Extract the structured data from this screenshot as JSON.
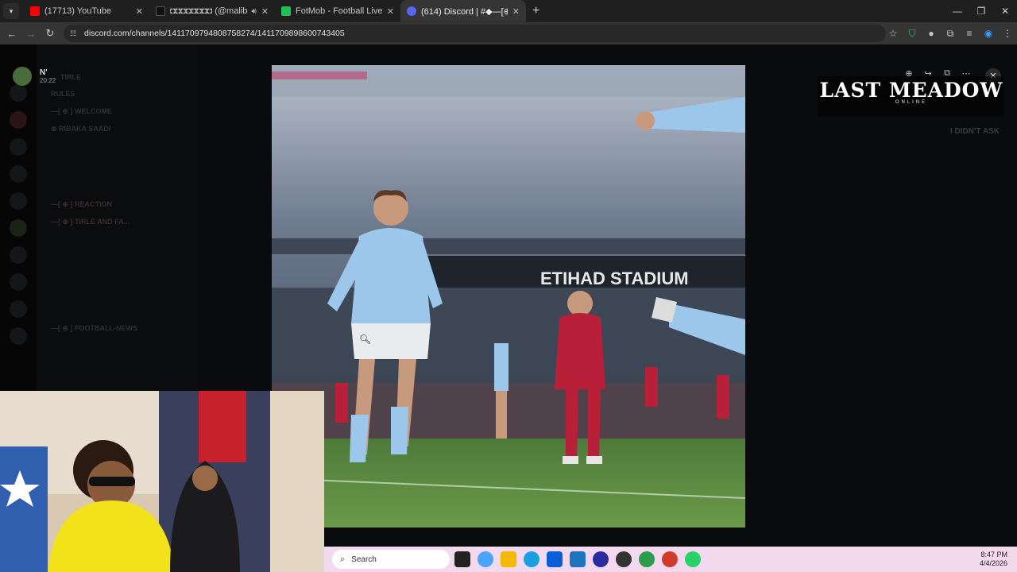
{
  "browser": {
    "tabs": [
      {
        "title": "(17713) YouTube",
        "favicon_color": "#ff0000",
        "active": false,
        "audio": false
      },
      {
        "title": "◘◘◘◘◘◘◘◘ (@maliboy1",
        "favicon_color": "#111111",
        "active": false,
        "audio": true
      },
      {
        "title": "FotMob - Football Live Scores",
        "favicon_color": "#1fbf55",
        "active": false,
        "audio": false
      },
      {
        "title": "(614) Discord | #◆—[⊕·⑦]REA",
        "favicon_color": "#5865f2",
        "active": true,
        "audio": false
      }
    ],
    "new_tab_icon": "plus-icon",
    "url": "discord.com/channels/1411709794808758274/1411709898600743405"
  },
  "discord": {
    "user": {
      "name": "N'",
      "time": "20:22"
    },
    "server_header": "TIRLE",
    "channels": [
      "RULES",
      "—[ ⊕ ] WELCOME",
      "⊕ RIBAKA SAADI",
      "—[ ⊕ ] REACTION",
      "—[ ⊕ ] TIRLE AND FA...",
      "—[ ⊕ ] FOOTBALL-NEWS"
    ],
    "dim_badge": "I DIDN'T ASK"
  },
  "overlay": {
    "logo_main": "LAST MEADOW",
    "logo_sub": "ONLINE"
  },
  "viewer": {
    "photo_caption_text": "ETIHAD STADIUM",
    "tools": [
      "zoom-icon",
      "forward-icon",
      "open-external-icon",
      "more-icon"
    ],
    "close_icon": "close-icon"
  },
  "taskbar": {
    "search_placeholder": "Search",
    "time": "8:47 PM",
    "date": "4/4/2026",
    "app_colors": [
      "#222222",
      "#4aa3ff",
      "#f5b800",
      "#1aa0e0",
      "#0b5ed7",
      "#1e73be",
      "#2b2b9e",
      "#333333",
      "#2c9c4a",
      "#d13b2e",
      "#25d366"
    ]
  }
}
